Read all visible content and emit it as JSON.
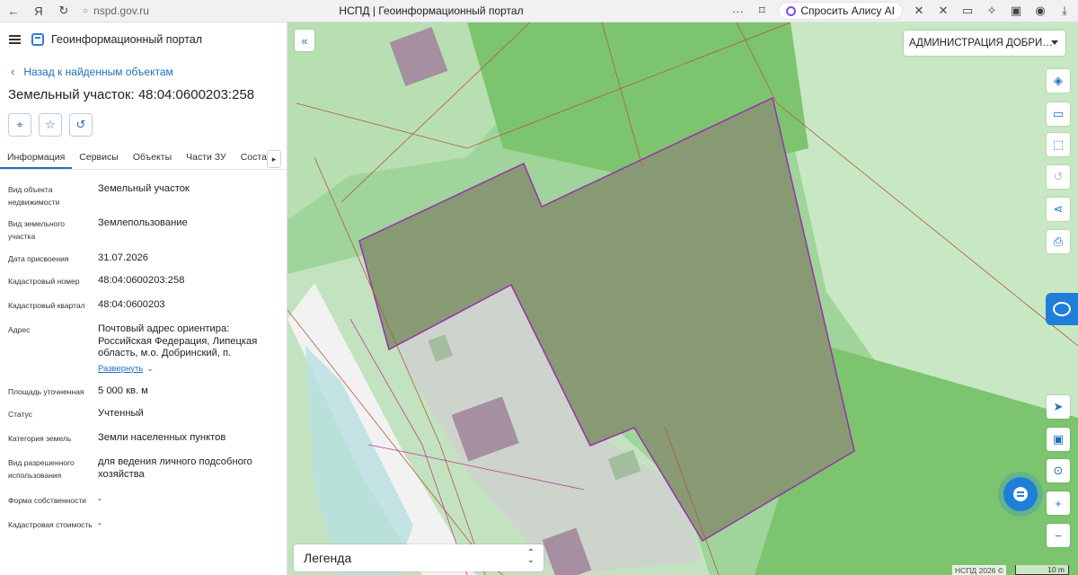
{
  "browser": {
    "url": "nspd.gov.ru",
    "tab_title": "НСПД | Геоинформационный портал",
    "alice_label": "Спросить Алису AI"
  },
  "app": {
    "title": "Геоинформационный портал",
    "back_link": "Назад к найденным объектам",
    "object_title": "Земельный участок: 48:04:0600203:258"
  },
  "tabs": [
    {
      "label": "Информация",
      "active": true
    },
    {
      "label": "Сервисы",
      "active": false
    },
    {
      "label": "Объекты",
      "active": false
    },
    {
      "label": "Части ЗУ",
      "active": false
    },
    {
      "label": "Состав",
      "active": false
    }
  ],
  "properties": [
    {
      "label": "Вид объекта недвижимости",
      "value": "Земельный участок"
    },
    {
      "label": "Вид земельного участка",
      "value": "Землепользование"
    },
    {
      "label": "Дата присвоения",
      "value": "31.07.2026"
    },
    {
      "label": "Кадастровый номер",
      "value": "48:04:0600203:258"
    },
    {
      "label": "Кадастровый квартал",
      "value": "48:04:0600203"
    },
    {
      "label": "Адрес",
      "value": "Почтовый адрес ориентира: Российская Федерация, Липецкая область, м.о. Добринский, п."
    },
    {
      "label": "Площадь уточненная",
      "value": "5 000 кв. м"
    },
    {
      "label": "Статус",
      "value": "Учтенный"
    },
    {
      "label": "Категория земель",
      "value": "Земли населенных пунктов"
    },
    {
      "label": "Вид разрешенного использования",
      "value": "для ведения личного подсобного хозяйства"
    },
    {
      "label": "Форма собственности",
      "value": "-"
    },
    {
      "label": "Кадастровая стоимость",
      "value": "-"
    }
  ],
  "expand_label": "Развернуть",
  "map": {
    "admin_select": "АДМИНИСТРАЦИЯ ДОБРИ…",
    "legend_label": "Легенда",
    "attribution": "НСПД 2026 ©",
    "scale_label": "10 m",
    "colors": {
      "field": "#9fd59a",
      "dark_green": "#7cc56e",
      "light_green": "#c7e8c3",
      "parcel_fill": "#879a74",
      "parcel_border": "#9b2fb0",
      "building": "#a58fa0"
    }
  }
}
